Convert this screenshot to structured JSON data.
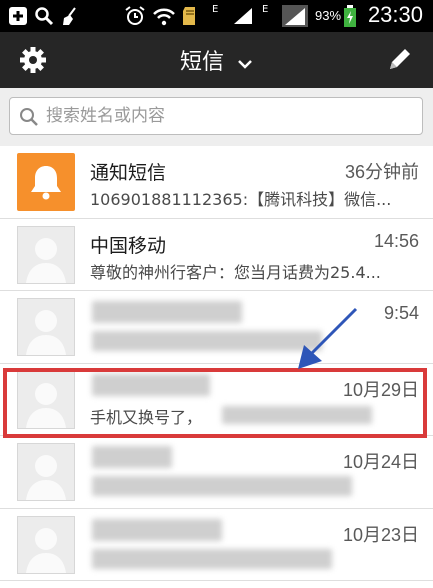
{
  "status_bar": {
    "time": "23:30",
    "battery": "93%",
    "network_label": "E",
    "icons": [
      "plus-icon",
      "search-icon",
      "broom-icon",
      "alarm-icon",
      "wifi-icon",
      "sd-card-icon",
      "signal-icon",
      "battery-icon"
    ]
  },
  "action_bar": {
    "title": "短信",
    "settings_icon": "gear-icon",
    "compose_icon": "pencil-icon"
  },
  "search": {
    "placeholder": "搜索姓名或内容"
  },
  "conversations": [
    {
      "name": "通知短信",
      "time": "36分钟前",
      "snippet": "106901881112365:【腾讯科技】微信...",
      "avatar": "bell-icon"
    },
    {
      "name": "中国移动",
      "time": "14:56",
      "snippet": "尊敬的神州行客户：您当月话费为25.4...",
      "avatar": "person-icon"
    },
    {
      "name": "",
      "time": "9:54",
      "snippet": "",
      "avatar": "person-icon"
    },
    {
      "name": "",
      "time": "10月29日",
      "snippet": "手机又换号了，",
      "avatar": "person-icon"
    },
    {
      "name": "",
      "time": "10月24日",
      "snippet": "",
      "avatar": "person-icon"
    },
    {
      "name": "",
      "time": "10月23日",
      "snippet": "",
      "avatar": "person-icon"
    }
  ],
  "colors": {
    "status_bar_bg": "#000000",
    "action_bar_bg": "#262626",
    "notify_avatar": "#f6902c",
    "highlight": "#d93a3a",
    "arrow": "#2e56b8"
  }
}
